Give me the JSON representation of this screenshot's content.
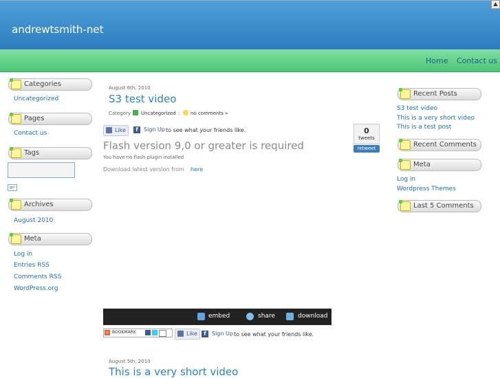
{
  "header": {
    "site_title": "andrewtsmith-net"
  },
  "nav": {
    "items": [
      "Home",
      "Contact us"
    ]
  },
  "left_sidebar": {
    "categories_title": "Categories",
    "categories": [
      "Uncategorized"
    ],
    "pages_title": "Pages",
    "pages": [
      "Contact us"
    ],
    "tags_title": "Tags",
    "tags_input_value": "",
    "go_label": "go!",
    "archives_title": "Archives",
    "archives": [
      "August 2010"
    ],
    "meta_title": "Meta",
    "meta_links": [
      "Log in",
      "Entries RSS",
      "Comments RSS",
      "WordPress.org"
    ]
  },
  "post1": {
    "date": "August 6th, 2010",
    "title": "S3 test video",
    "category_label": "Category",
    "category_value": "Uncategorized",
    "separator": ":",
    "comments": "no comments »",
    "like_label": "Like",
    "signup_link": "Sign Up",
    "signup_text": "to see what your friends like.",
    "tweet_count": "0",
    "tweets_label": "tweets",
    "retweet_label": "retweet",
    "flash_heading": "Flash version 9,0 or greater is required",
    "no_plugin": "You have no flash plugin installed",
    "download_text": "Download latest version from",
    "download_link": "here",
    "video_bar": {
      "embed": "embed",
      "share": "share",
      "download": "download"
    },
    "bookmark_label": "BOOKMARK"
  },
  "post2": {
    "date": "August 5th, 2010",
    "title": "This is a very short video"
  },
  "right_sidebar": {
    "recent_posts_title": "Recent Posts",
    "recent_posts": [
      "S3 test video",
      "This is a very short video",
      "This is a test post"
    ],
    "recent_comments_title": "Recent Comments",
    "meta_title": "Meta",
    "meta_links": [
      "Log in",
      "Wordpress Themes"
    ],
    "last_comments_title": "Last 5 Comments"
  }
}
